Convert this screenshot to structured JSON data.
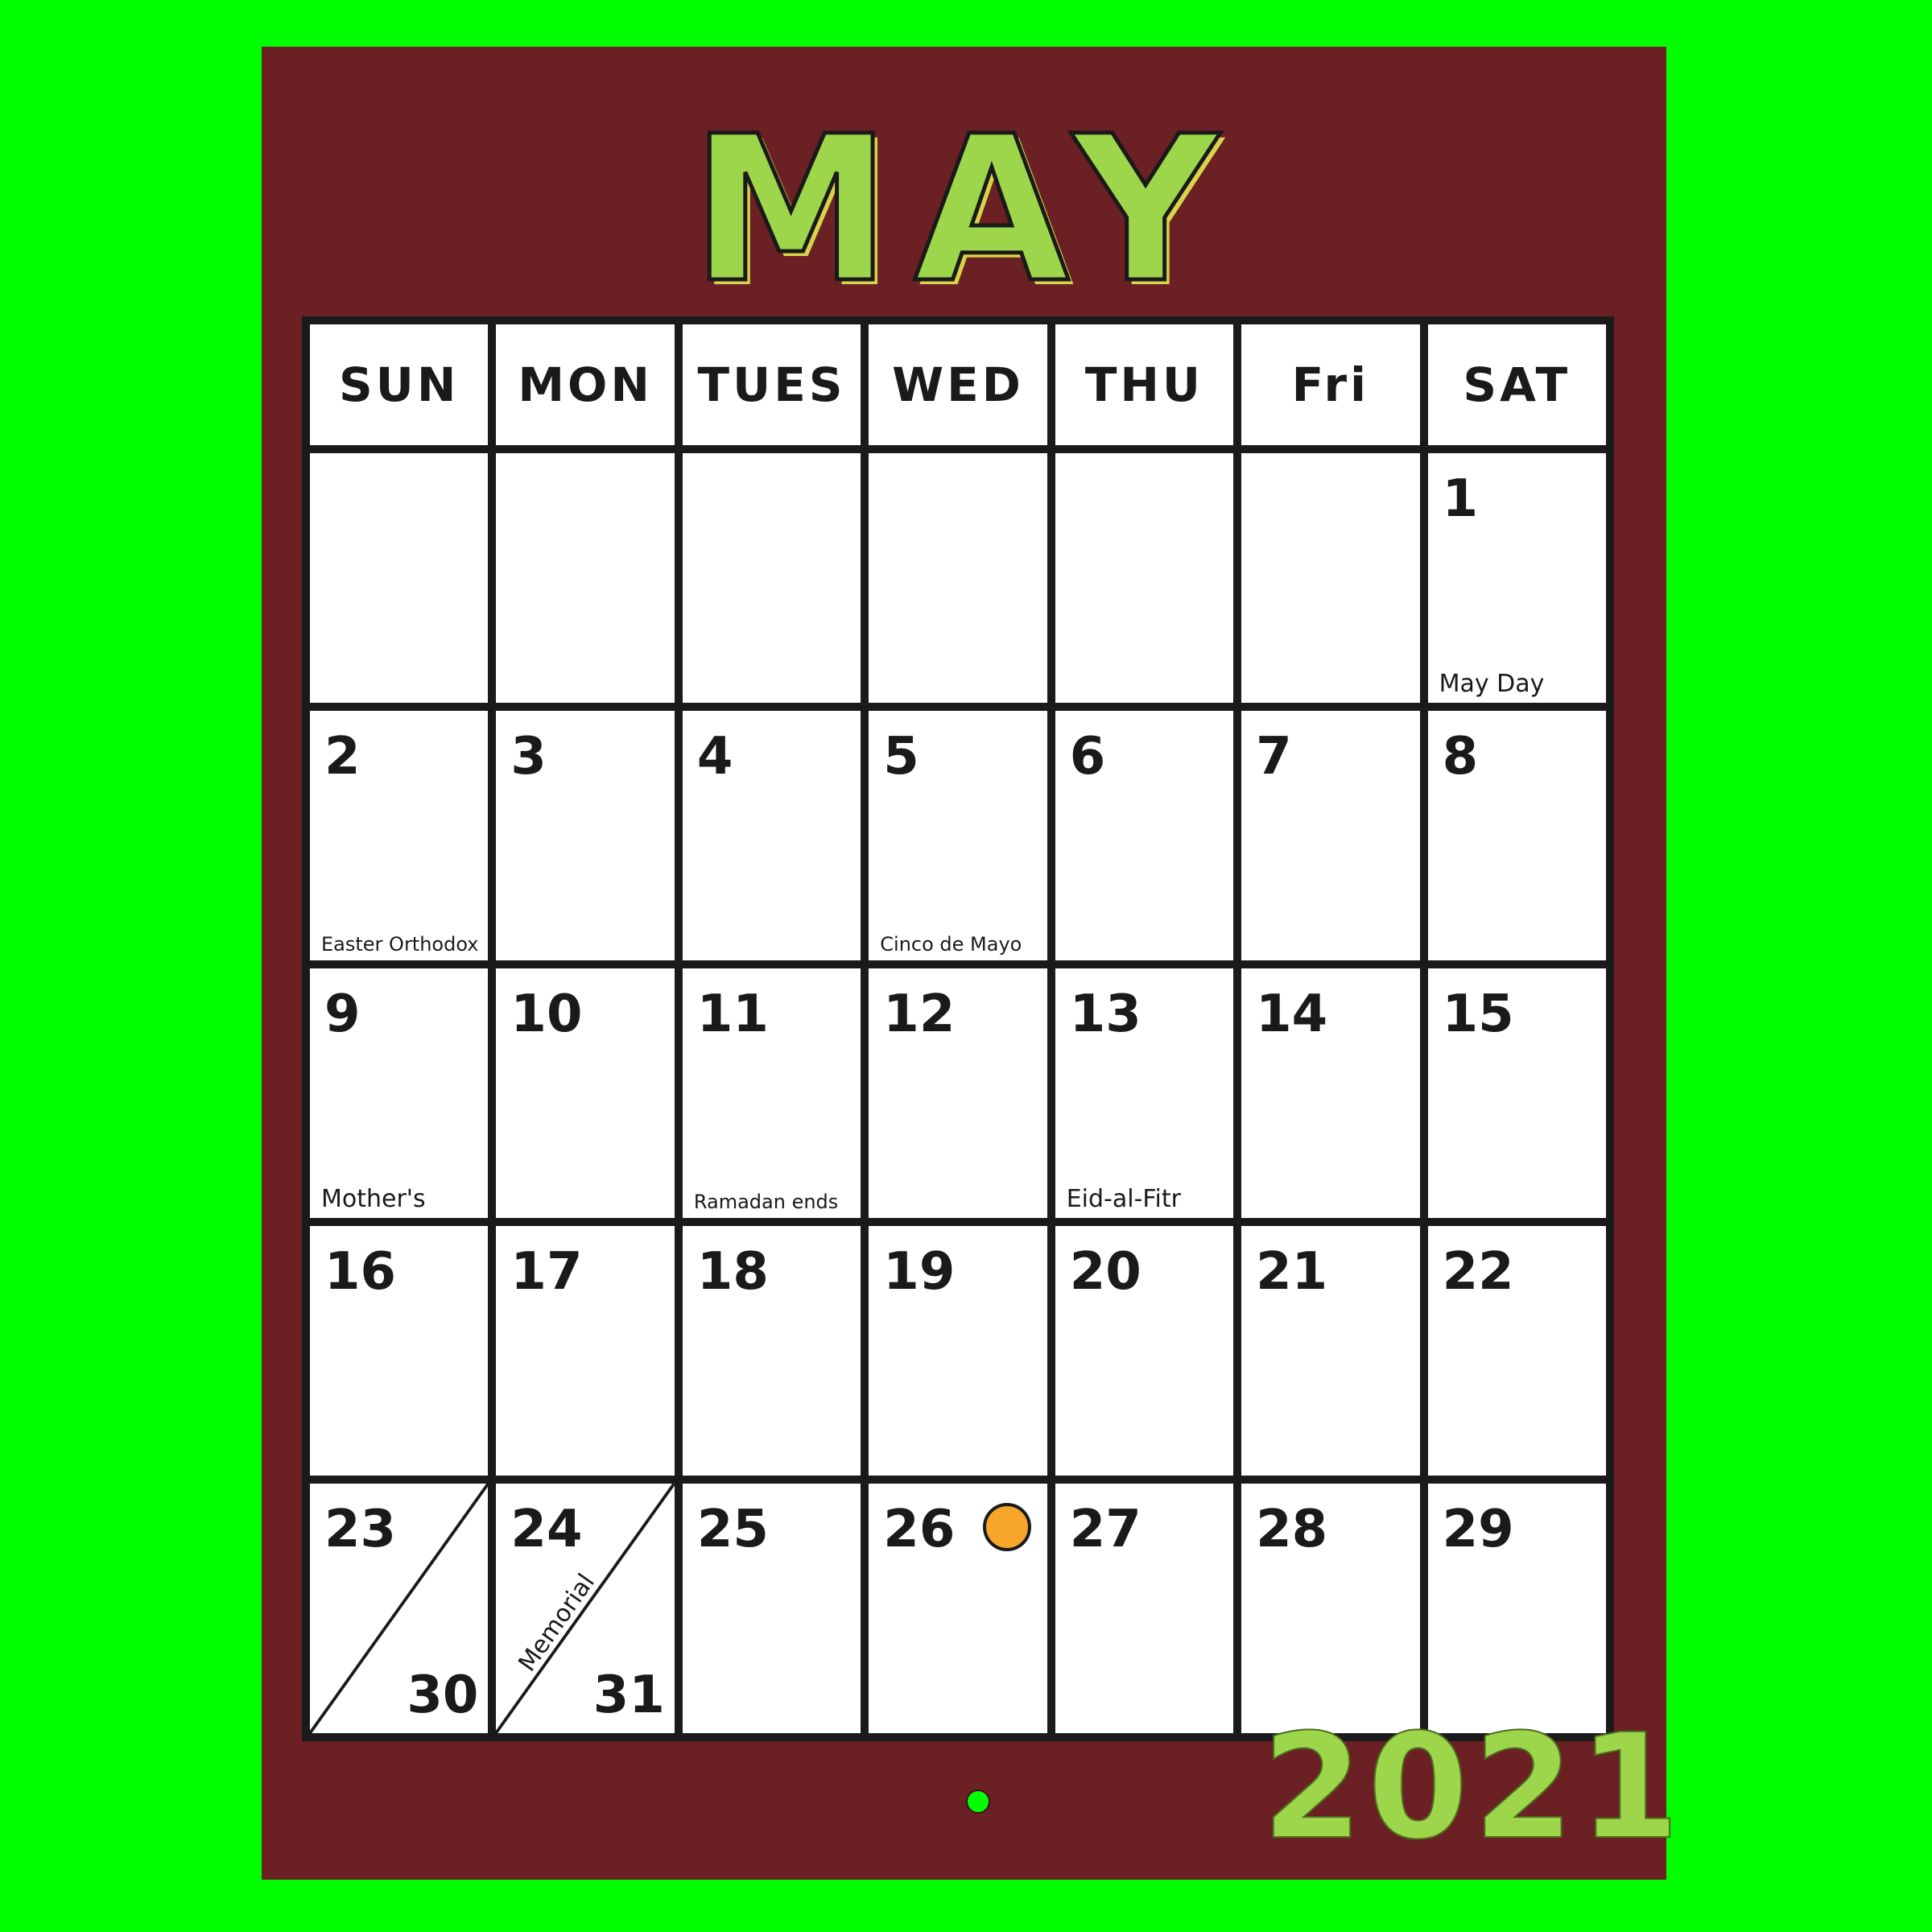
{
  "calendar": {
    "month": "MAY",
    "year": "2021",
    "weekdays": [
      "SUN",
      "MON",
      "TUES",
      "WED",
      "THU",
      "Fri",
      "SAT"
    ],
    "weeks": [
      [
        {
          "num": "",
          "note": ""
        },
        {
          "num": "",
          "note": ""
        },
        {
          "num": "",
          "note": ""
        },
        {
          "num": "",
          "note": ""
        },
        {
          "num": "",
          "note": ""
        },
        {
          "num": "",
          "note": ""
        },
        {
          "num": "1",
          "note": "May Day"
        }
      ],
      [
        {
          "num": "2",
          "note": "Easter Orthodox"
        },
        {
          "num": "3",
          "note": ""
        },
        {
          "num": "4",
          "note": ""
        },
        {
          "num": "5",
          "note": "Cinco de Mayo"
        },
        {
          "num": "6",
          "note": ""
        },
        {
          "num": "7",
          "note": ""
        },
        {
          "num": "8",
          "note": ""
        }
      ],
      [
        {
          "num": "9",
          "note": "Mother's"
        },
        {
          "num": "10",
          "note": ""
        },
        {
          "num": "11",
          "note": "Ramadan ends"
        },
        {
          "num": "12",
          "note": ""
        },
        {
          "num": "13",
          "note": "Eid-al-Fitr"
        },
        {
          "num": "14",
          "note": ""
        },
        {
          "num": "15",
          "note": ""
        }
      ],
      [
        {
          "num": "16",
          "note": ""
        },
        {
          "num": "17",
          "note": ""
        },
        {
          "num": "18",
          "note": ""
        },
        {
          "num": "19",
          "note": ""
        },
        {
          "num": "20",
          "note": ""
        },
        {
          "num": "21",
          "note": ""
        },
        {
          "num": "22",
          "note": ""
        }
      ],
      [
        {
          "num": "23",
          "num2": "30",
          "note": ""
        },
        {
          "num": "24",
          "num2": "31",
          "note": "Memorial"
        },
        {
          "num": "25",
          "note": ""
        },
        {
          "num": "26",
          "note": ""
        },
        {
          "num": "27",
          "note": ""
        },
        {
          "num": "28",
          "note": ""
        },
        {
          "num": "29",
          "note": ""
        }
      ]
    ],
    "moon_marker": {
      "day": "26",
      "color": "#f7a629",
      "icon": "full-moon-icon"
    },
    "colors": {
      "background": "#00ff00",
      "page": "#6b2124",
      "title": "#9dd64a"
    }
  }
}
